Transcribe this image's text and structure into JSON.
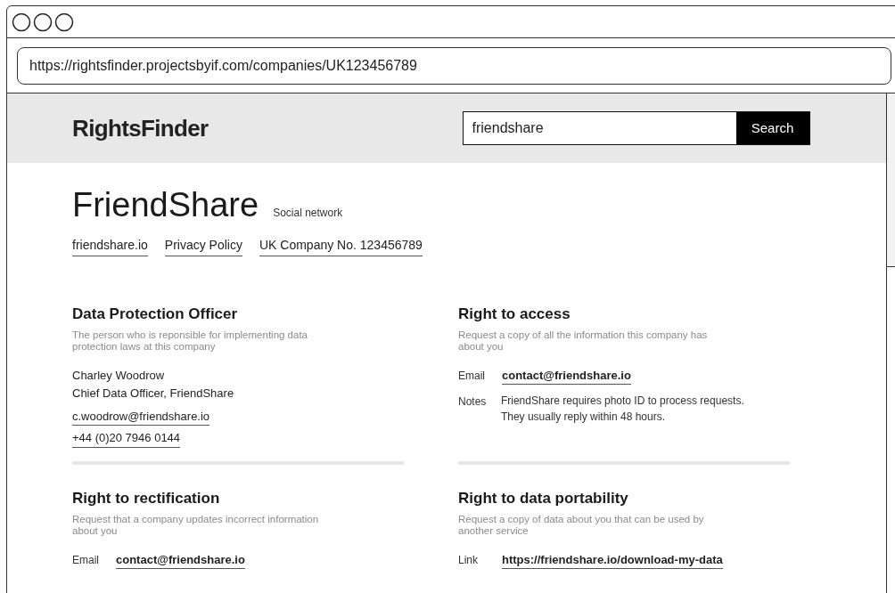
{
  "browser": {
    "url": "https://rightsfinder.projectsbyif.com/companies/UK123456789"
  },
  "header": {
    "logo": "RightsFinder",
    "search": {
      "value": "friendshare",
      "button": "Search"
    }
  },
  "company": {
    "name": "FriendShare",
    "category": "Social network",
    "links": [
      "friendshare.io",
      "Privacy Policy",
      "UK Company No. 123456789"
    ]
  },
  "sections": [
    {
      "kind": "contact",
      "title": "Data Protection Officer",
      "description": "The person who is reponsible for implementing data protection laws at this company",
      "lines": [
        "Charley Woodrow",
        "Chief Data Officer, FriendShare"
      ],
      "links": [
        "c.woodrow@friendshare.io",
        "+44 (0)20 7946 0144"
      ]
    },
    {
      "kind": "fields",
      "title": "Right to access",
      "description": "Request a copy of all the information this company has about you",
      "fields": [
        {
          "label": "Email",
          "value": "contact@friendshare.io",
          "kind": "link"
        },
        {
          "label": "Notes",
          "value": "FriendShare requires photo ID to process requests. They usually reply within 48 hours.",
          "kind": "text"
        }
      ]
    },
    {
      "kind": "fields",
      "title": "Right to rectification",
      "description": "Request that a company updates incorrect information about you",
      "fields": [
        {
          "label": "Email",
          "value": "contact@friendshare.io",
          "kind": "link"
        }
      ]
    },
    {
      "kind": "fields",
      "title": "Right to data portability",
      "description": "Request a copy of data about you that can be used by another service",
      "fields": [
        {
          "label": "Link",
          "value": "https://friendshare.io/download-my-data",
          "kind": "link"
        }
      ]
    }
  ]
}
